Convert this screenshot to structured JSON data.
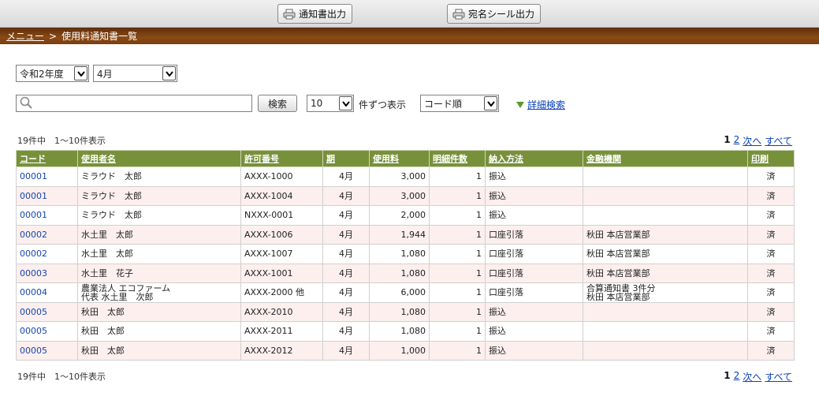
{
  "toolbar": {
    "notice_label": "通知書出力",
    "seal_label": "宛名シール出力"
  },
  "breadcrumb": {
    "menu": "メニュー",
    "separator": ">",
    "current": "使用料通知書一覧"
  },
  "filters": {
    "year": "令和2年度",
    "month": "4月",
    "search_value": "",
    "search_button": "検索",
    "per_page": "10",
    "per_page_label": "件ずつ表示",
    "sort": "コード順",
    "advanced_search": "詳細検索"
  },
  "summary": {
    "count_text": "19件中　1〜10件表示"
  },
  "pager": {
    "current": "1",
    "page2": "2",
    "next": "次へ",
    "all": "すべて"
  },
  "table": {
    "headers": [
      "コード",
      "使用者名",
      "許可番号",
      "期",
      "使用料",
      "明細件数",
      "納入方法",
      "金融機関",
      "印刷"
    ],
    "rows": [
      {
        "code": "00001",
        "name": "ミラウド　太郎",
        "permit": "AXXX-1000",
        "period": "4月",
        "fee": "3,000",
        "items": "1",
        "method": "振込",
        "bank": "",
        "print": "済"
      },
      {
        "code": "00001",
        "name": "ミラウド　太郎",
        "permit": "AXXX-1004",
        "period": "4月",
        "fee": "3,000",
        "items": "1",
        "method": "振込",
        "bank": "",
        "print": "済"
      },
      {
        "code": "00001",
        "name": "ミラウド　太郎",
        "permit": "NXXX-0001",
        "period": "4月",
        "fee": "2,000",
        "items": "1",
        "method": "振込",
        "bank": "",
        "print": "済"
      },
      {
        "code": "00002",
        "name": "水土里　太郎",
        "permit": "AXXX-1006",
        "period": "4月",
        "fee": "1,944",
        "items": "1",
        "method": "口座引落",
        "bank": "秋田 本店営業部",
        "print": "済"
      },
      {
        "code": "00002",
        "name": "水土里　太郎",
        "permit": "AXXX-1007",
        "period": "4月",
        "fee": "1,080",
        "items": "1",
        "method": "口座引落",
        "bank": "秋田 本店営業部",
        "print": "済"
      },
      {
        "code": "00003",
        "name": "水土里　花子",
        "permit": "AXXX-1001",
        "period": "4月",
        "fee": "1,080",
        "items": "1",
        "method": "口座引落",
        "bank": "秋田 本店営業部",
        "print": "済"
      },
      {
        "code": "00004",
        "name": "農業法人 エコファーム\n代表 水土里　次郎",
        "permit": "AXXX-2000 他",
        "period": "4月",
        "fee": "6,000",
        "items": "1",
        "method": "口座引落",
        "bank": "合算通知書 3件分\n秋田 本店営業部",
        "print": "済"
      },
      {
        "code": "00005",
        "name": "秋田　太郎",
        "permit": "AXXX-2010",
        "period": "4月",
        "fee": "1,080",
        "items": "1",
        "method": "振込",
        "bank": "",
        "print": "済"
      },
      {
        "code": "00005",
        "name": "秋田　太郎",
        "permit": "AXXX-2011",
        "period": "4月",
        "fee": "1,080",
        "items": "1",
        "method": "振込",
        "bank": "",
        "print": "済"
      },
      {
        "code": "00005",
        "name": "秋田　太郎",
        "permit": "AXXX-2012",
        "period": "4月",
        "fee": "1,000",
        "items": "1",
        "method": "振込",
        "bank": "",
        "print": "済"
      }
    ]
  },
  "colors": {
    "header_green": "#77913a",
    "breadcrumb_brown": "#7a3e0f",
    "row_pink": "#fcefee",
    "link_blue": "#0b41b8"
  },
  "icons": {
    "printer": "printer-icon",
    "search": "magnifier-icon",
    "dropdown": "chevron-down-icon",
    "advanced": "triangle-down-icon"
  }
}
